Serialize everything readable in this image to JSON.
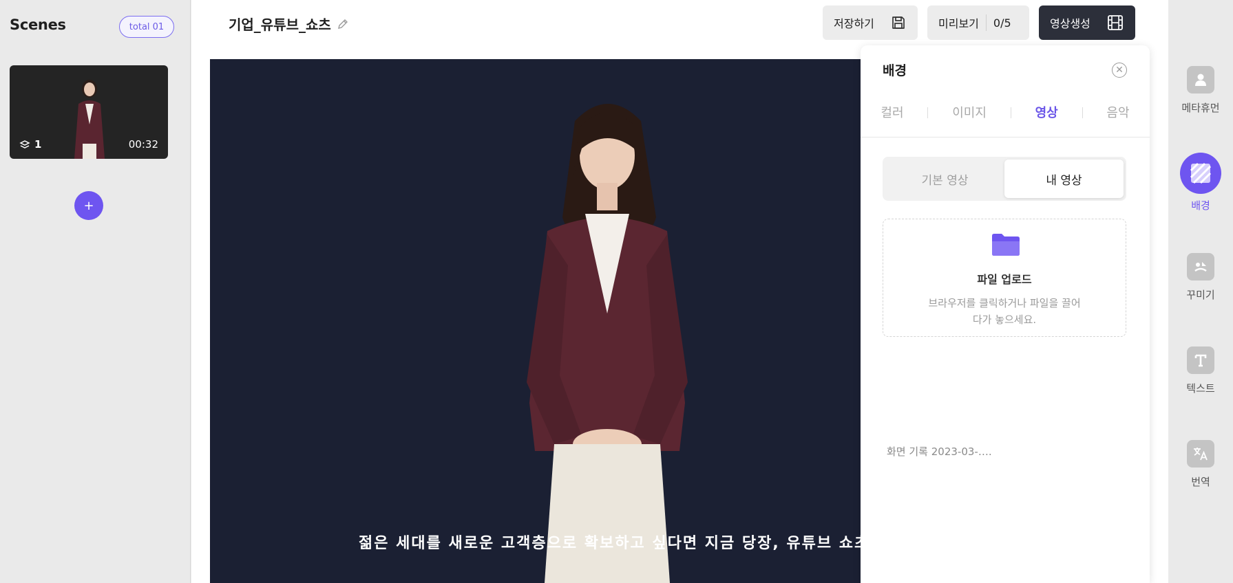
{
  "scenes": {
    "title": "Scenes",
    "total_badge": "total 01",
    "cards": [
      {
        "layers": "1",
        "duration": "00:32"
      }
    ],
    "add_label": "+"
  },
  "editor": {
    "project_title": "기업_유튜브_쇼츠",
    "save_label": "저장하기",
    "preview_label": "미리보기",
    "preview_count": "0/5",
    "generate_label": "영상생성",
    "subtitle": "젊은 세대를 새로운 고객층으로 확보하고 싶다면 지금 당장, 유튜브 쇼츠"
  },
  "background_panel": {
    "title": "배경",
    "tabs": [
      "컬러",
      "이미지",
      "영상",
      "음악"
    ],
    "active_tab": "영상",
    "segments": [
      "기본 영상",
      "내 영상"
    ],
    "active_segment": "내 영상",
    "upload_title": "파일 업로드",
    "upload_desc": "브라우저를 클릭하거나 파일을 끌어다가 놓으세요.",
    "file_name": "화면 기록 2023-03-…."
  },
  "toolbar": {
    "items": [
      {
        "label": "메타휴먼",
        "icon": "person-icon"
      },
      {
        "label": "배경",
        "icon": "background-icon"
      },
      {
        "label": "꾸미기",
        "icon": "sticker-icon"
      },
      {
        "label": "텍스트",
        "icon": "text-icon"
      },
      {
        "label": "번역",
        "icon": "translate-icon"
      }
    ],
    "active": "배경"
  },
  "colors": {
    "accent": "#6e55f0",
    "canvas_bg": "#1b2033",
    "generate_bg": "#2c2f3a"
  }
}
